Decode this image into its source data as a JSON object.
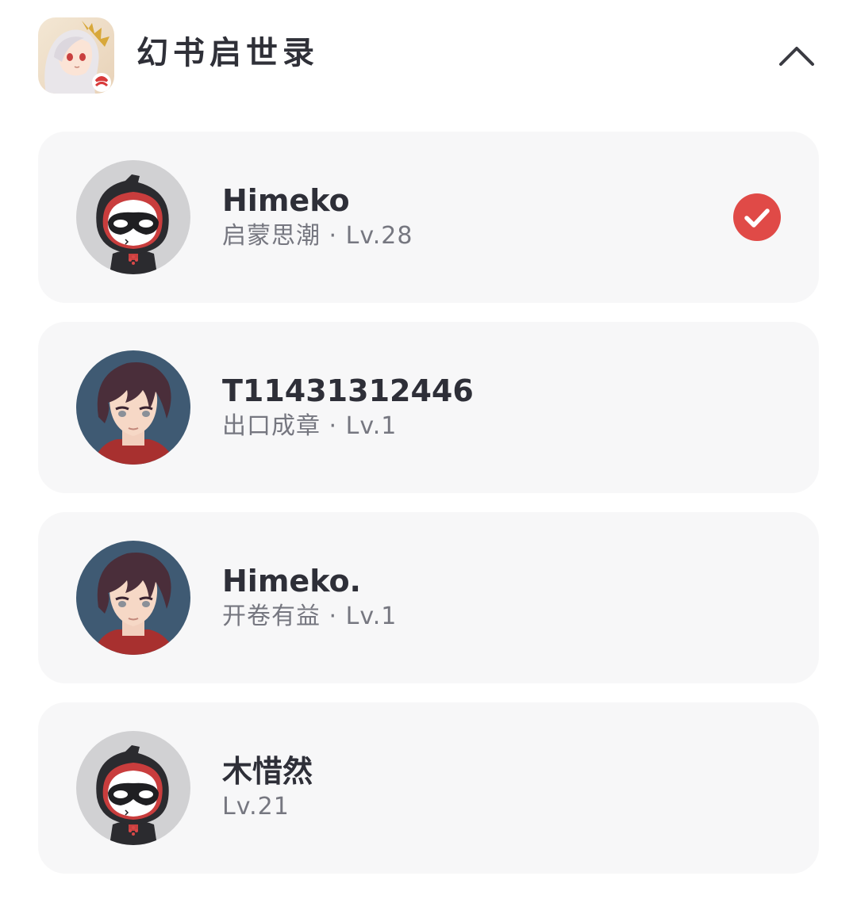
{
  "app": {
    "title": "幻书启世录",
    "icon": "game-app-icon",
    "collapse_icon": "chevron-up-icon"
  },
  "accounts": [
    {
      "name": "Himeko",
      "meta": "启蒙思潮 · Lv.28",
      "avatar": "masked-hood-avatar",
      "selected": true
    },
    {
      "name": "T11431312446",
      "meta": "出口成章 · Lv.1",
      "avatar": "anime-boy-avatar",
      "selected": false
    },
    {
      "name": "Himeko.",
      "meta": "开卷有益 · Lv.1",
      "avatar": "anime-boy-avatar",
      "selected": false
    },
    {
      "name": "木惜然",
      "meta": "Lv.21",
      "avatar": "masked-hood-avatar",
      "selected": false
    }
  ],
  "colors": {
    "card_bg": "#f7f7f8",
    "check": "#e04a47",
    "name": "#2e2f38",
    "meta": "#767780"
  }
}
